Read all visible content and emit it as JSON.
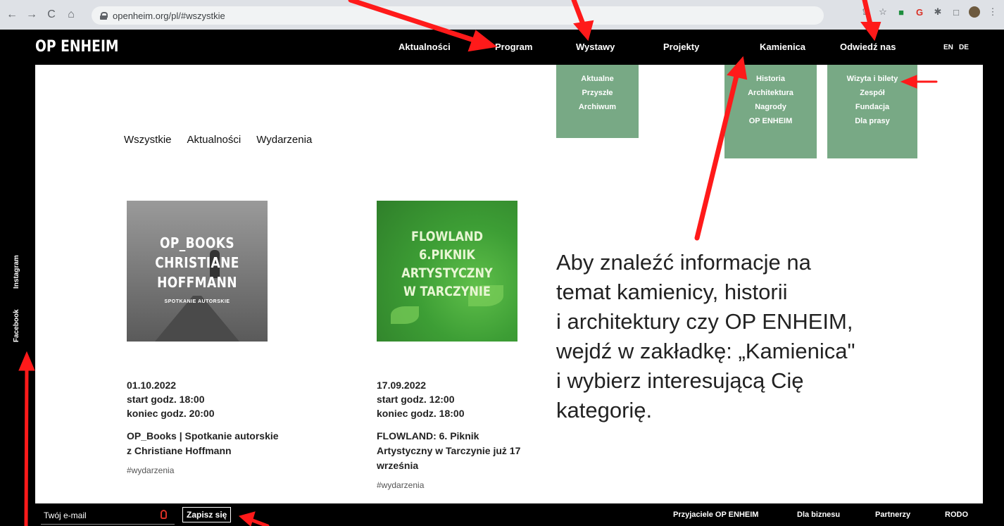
{
  "browser": {
    "url": "openheim.org/pl/#wszystkie",
    "back_icon": "←",
    "forward_icon": "→",
    "reload_icon": "C",
    "home_icon": "⌂"
  },
  "site": {
    "logo": "OP ENHEIM",
    "nav": [
      "Aktualności",
      "Program",
      "Wystawy",
      "Projekty",
      "Kamienica",
      "Odwiedź nas"
    ],
    "lang": [
      "EN",
      "DE"
    ]
  },
  "dropdowns": {
    "wystawy": [
      "Aktualne",
      "Przyszłe",
      "Archiwum"
    ],
    "kamienica": [
      "Historia",
      "Architektura",
      "Nagrody",
      "OP ENHEIM"
    ],
    "odwiedz": [
      "Wizyta i bilety",
      "Zespół",
      "Fundacja",
      "Dla prasy"
    ]
  },
  "filters": [
    "Wszystkie",
    "Aktualności",
    "Wydarzenia"
  ],
  "cards": [
    {
      "thumb_lines": [
        "OP_BOOKS",
        "CHRISTIANE",
        "HOFFMANN"
      ],
      "thumb_sub": "SPOTKANIE AUTORSKIE",
      "date": "01.10.2022",
      "start": "start godz. 18:00",
      "end": "koniec godz. 20:00",
      "title": "OP_Books | Spotkanie autorskie z Christiane Hoffmann",
      "tag": "#wydarzenia"
    },
    {
      "thumb_lines": [
        "FLOWLAND",
        "6.PIKNIK",
        "ARTYSTYCZNY",
        "W TARCZYNIE"
      ],
      "date": "17.09.2022",
      "start": "start godz. 12:00",
      "end": "koniec godz. 18:00",
      "title": "FLOWLAND: 6. Piknik Artystyczny w Tarczynie już 17 września",
      "tag": "#wydarzenia"
    }
  ],
  "annotation": [
    "Aby znaleźć informacje na",
    "temat kamienicy, historii",
    "i architektury czy OP ENHEIM,",
    "wejdź w zakładkę: „Kamienica\"",
    "i wybierz interesującą Cię",
    "kategorię."
  ],
  "social": [
    "Instagram",
    "Facebook"
  ],
  "footer": {
    "email_placeholder": "Twój e-mail",
    "subscribe": "Zapisz się",
    "links": [
      "Przyjaciele OP ENHEIM",
      "Dla biznesu",
      "Partnerzy",
      "RODO"
    ]
  },
  "colors": {
    "dropdown_bg": "#78a985",
    "arrow": "#ff1a1a",
    "header_bg": "#000000"
  }
}
